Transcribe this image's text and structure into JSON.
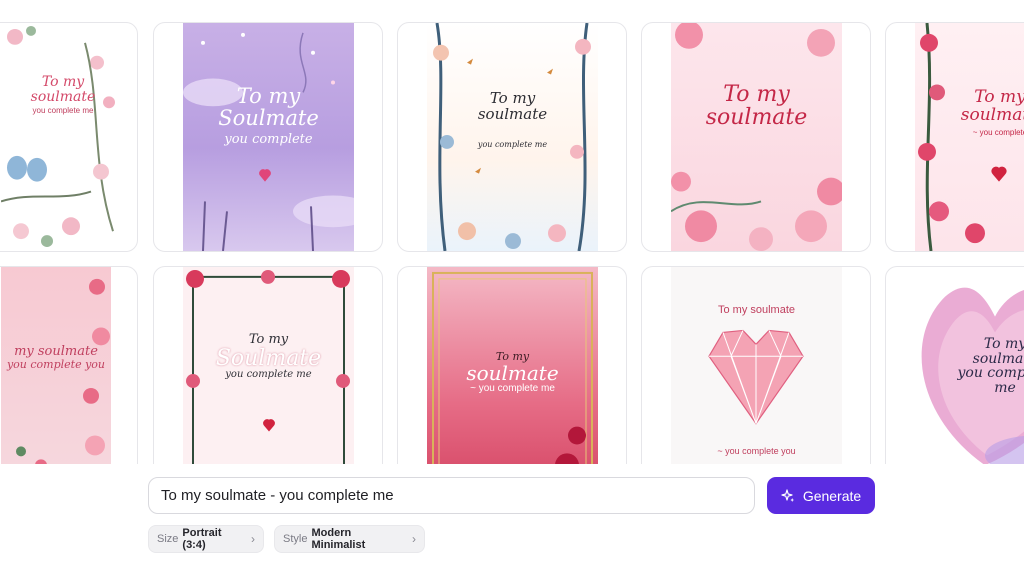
{
  "gallery": {
    "cards": [
      {
        "lines": [
          "To my",
          "soulmate",
          "you complete me"
        ]
      },
      {
        "lines": [
          "To my",
          "Soulmate",
          "you complete"
        ]
      },
      {
        "lines": [
          "To my",
          "soulmate",
          "you complete me"
        ]
      },
      {
        "lines": [
          "To my",
          "soulmate"
        ]
      },
      {
        "lines": [
          "To my",
          "soulmate",
          "~ you complete"
        ]
      },
      {
        "lines": [
          "my soulmate",
          "you complete you"
        ]
      },
      {
        "lines": [
          "To my",
          "Soulmate",
          "you complete me"
        ]
      },
      {
        "lines": [
          "To my",
          "soulmate",
          "~ you complete me"
        ]
      },
      {
        "lines": [
          "To my soulmate",
          "~ you complete you"
        ]
      },
      {
        "lines": [
          "To my",
          "soulmate",
          "you complete",
          "me"
        ]
      }
    ]
  },
  "prompt": {
    "value": "To my soulmate - you complete me"
  },
  "generate": {
    "label": "Generate",
    "icon": "sparkle-icon",
    "color": "#5a2be0"
  },
  "options": {
    "size": {
      "key": "Size",
      "value": "Portrait (3:4)"
    },
    "style": {
      "key": "Style",
      "value": "Modern Minimalist"
    }
  }
}
